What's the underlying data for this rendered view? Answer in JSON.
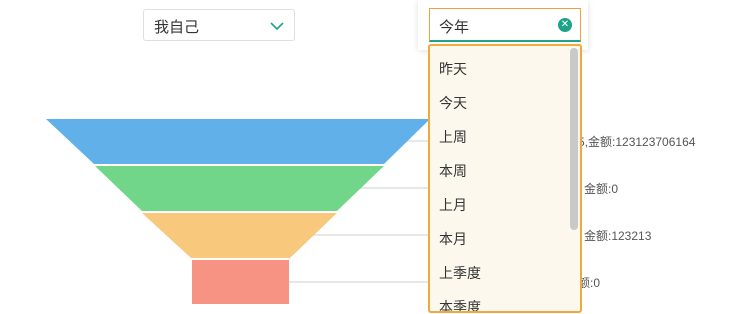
{
  "owner_filter": {
    "value": "我自己"
  },
  "chart_data": {
    "type": "funnel",
    "stages": [
      {
        "label": "5,金额:123123706164",
        "color": "#62b0ea"
      },
      {
        "label": "金额:0",
        "color": "#72d68a"
      },
      {
        "label": "金额:123213",
        "color": "#f8c97d"
      },
      {
        "label": "额:0",
        "color": "#f69383"
      }
    ]
  },
  "period_select": {
    "value": "今年",
    "options": [
      "昨天",
      "今天",
      "上周",
      "本周",
      "上月",
      "本月",
      "上季度",
      "本季度"
    ]
  },
  "colors": {
    "accent": "#1ea389",
    "focus_border": "#f0a93d",
    "dropdown_bg": "#fdf8ee"
  }
}
